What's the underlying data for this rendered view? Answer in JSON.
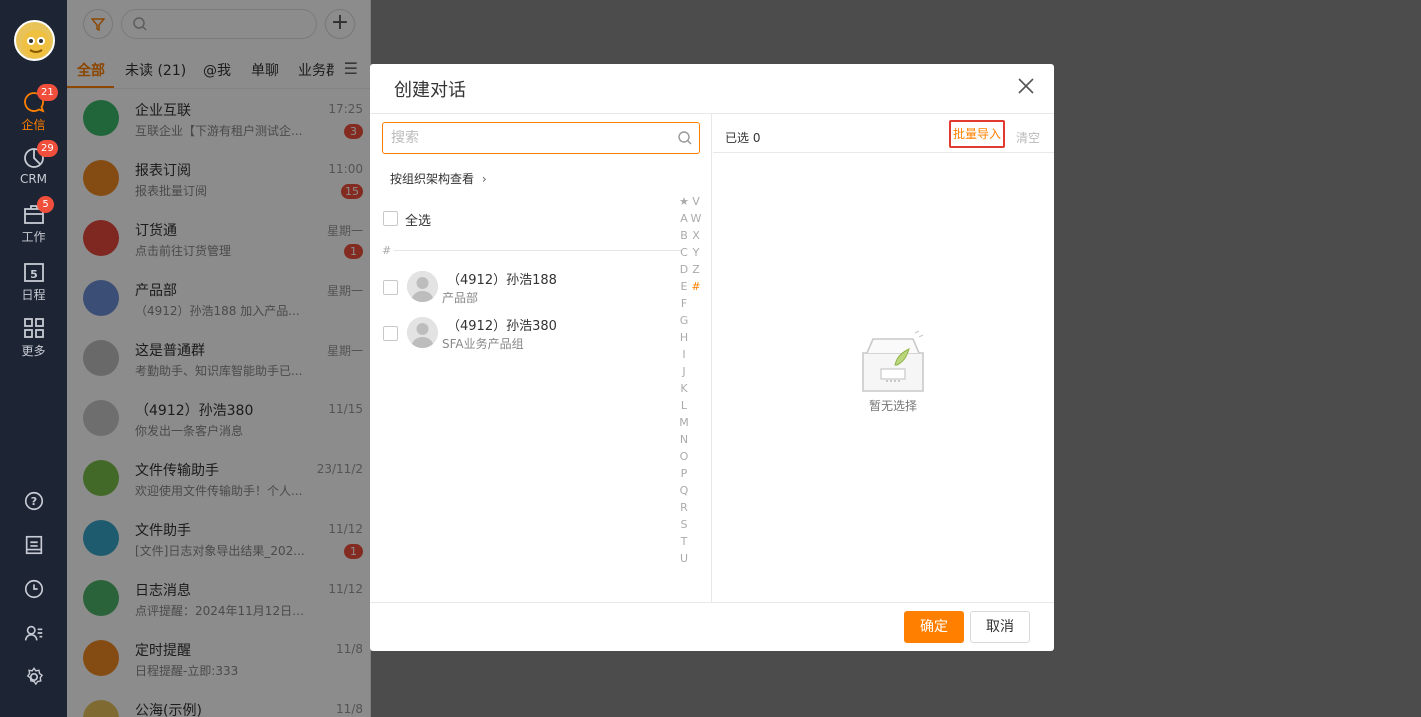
{
  "nav": {
    "items": [
      {
        "label": "企信",
        "badge": "21",
        "icon": "chat-icon"
      },
      {
        "label": "CRM",
        "badge": "29",
        "icon": "crm-icon"
      },
      {
        "label": "工作",
        "badge": "5",
        "icon": "work-icon"
      },
      {
        "label": "日程",
        "badge": "",
        "icon": "calendar-icon",
        "day": "5"
      },
      {
        "label": "更多",
        "badge": "",
        "icon": "grid-icon"
      }
    ],
    "bottom_icons": [
      "help-icon",
      "notebook-icon",
      "clock-icon",
      "contacts-icon",
      "settings-icon"
    ]
  },
  "list": {
    "tabs": [
      "全部",
      "未读 (21)",
      "@我",
      "单聊",
      "业务群"
    ],
    "conversations": [
      {
        "name": "企业互联",
        "preview": "互联企业【下游有租户测试企...",
        "time": "17:25",
        "badge": "3",
        "color": "#3db86b"
      },
      {
        "name": "报表订阅",
        "preview": "报表批量订阅",
        "time": "11:00",
        "badge": "15",
        "color": "#f08a24"
      },
      {
        "name": "订货通",
        "preview": "点击前往订货管理",
        "time": "星期一",
        "badge": "1",
        "color": "#e8483d"
      },
      {
        "name": "产品部",
        "preview": "（4912）孙浩188 加入产品...",
        "time": "星期一",
        "badge": "",
        "color": "#6c8fd6"
      },
      {
        "name": "这是普通群",
        "preview": "考勤助手、知识库智能助手已...",
        "time": "星期一",
        "badge": "",
        "color": "#bfbfbf"
      },
      {
        "name": "（4912）孙浩380",
        "preview": "你发出一条客户消息",
        "time": "11/15",
        "badge": "",
        "color": "#c8c8c8"
      },
      {
        "name": "文件传输助手",
        "preview": "欢迎使用文件传输助手！个人...",
        "time": "23/11/2",
        "badge": "",
        "color": "#7bbf4a"
      },
      {
        "name": "文件助手",
        "preview": "[文件]日志对象导出结果_202...",
        "time": "11/12",
        "badge": "1",
        "color": "#3aa7c9"
      },
      {
        "name": "日志消息",
        "preview": "点评提醒：2024年11月12日 ...",
        "time": "11/12",
        "badge": "",
        "color": "#4db36a"
      },
      {
        "name": "定时提醒",
        "preview": "日程提醒-立即:333",
        "time": "11/8",
        "badge": "",
        "color": "#f08a24"
      },
      {
        "name": "公海(示例)",
        "preview": "",
        "time": "11/8",
        "badge": "",
        "color": "#e7c35a"
      }
    ]
  },
  "dialog": {
    "title": "创建对话",
    "search_placeholder": "搜索",
    "org_link": "按组织架构查看",
    "select_all": "全选",
    "group_letter": "#",
    "people": [
      {
        "name": "（4912）孙浩188",
        "dept": "产品部"
      },
      {
        "name": "（4912）孙浩380",
        "dept": "SFA业务产品组"
      }
    ],
    "alpha_col1": [
      "★",
      "A",
      "B",
      "C",
      "D",
      "E",
      "F",
      "G",
      "H",
      "I",
      "J",
      "K",
      "L",
      "M",
      "N",
      "O",
      "P",
      "Q",
      "R",
      "S",
      "T",
      "U"
    ],
    "alpha_col2": [
      "V",
      "W",
      "X",
      "Y",
      "Z",
      "#"
    ],
    "selected_label": "已选 0",
    "batch_import": "批量导入",
    "clear": "清空",
    "empty_text": "暂无选择",
    "ok": "确定",
    "cancel": "取消"
  }
}
